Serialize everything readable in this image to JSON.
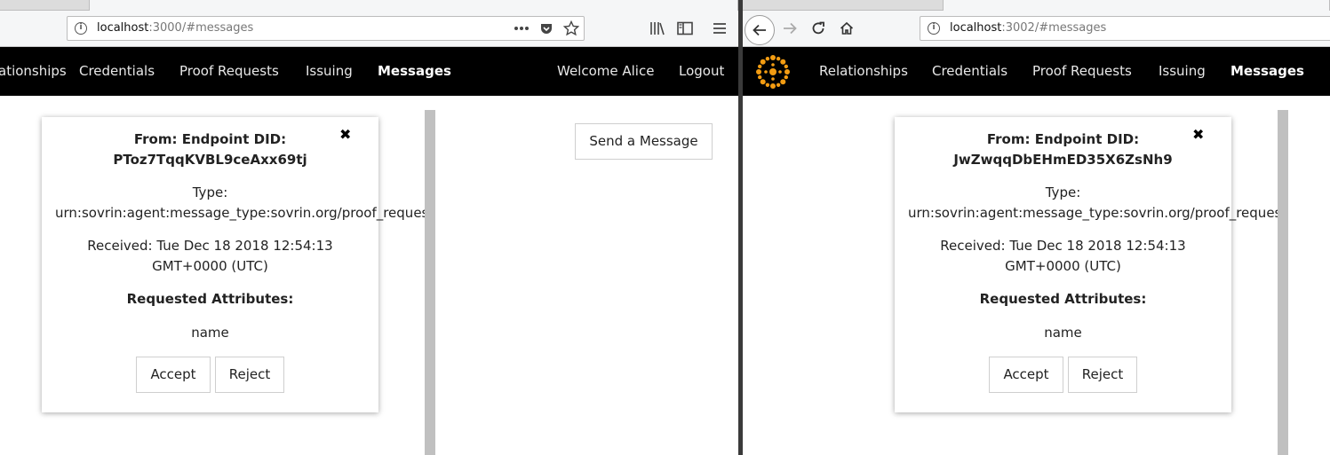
{
  "left": {
    "url_host": "localhost",
    "url_path": ":3000/#messages",
    "nav": {
      "items": [
        "ationships",
        "Credentials",
        "Proof Requests",
        "Issuing",
        "Messages"
      ],
      "welcome": "Welcome Alice",
      "logout": "Logout"
    },
    "card": {
      "from_label": "From: Endpoint DID:",
      "did": "PToz7TqqKVBL9ceAxx69tj",
      "type_label": "Type:",
      "type_value": "urn:sovrin:agent:message_type:sovrin.org/proof_request",
      "received_1": "Received: Tue Dec 18 2018 12:54:13",
      "received_2": "GMT+0000 (UTC)",
      "requested_label": "Requested Attributes:",
      "attribute": "name",
      "accept": "Accept",
      "reject": "Reject",
      "close": "✖"
    },
    "send_message": "Send a Message"
  },
  "right": {
    "url_host": "localhost",
    "url_path": ":3002/#messages",
    "nav": {
      "items": [
        "Relationships",
        "Credentials",
        "Proof Requests",
        "Issuing",
        "Messages"
      ]
    },
    "card": {
      "from_label": "From: Endpoint DID:",
      "did": "JwZwqqDbEHmED35X6ZsNh9",
      "type_label": "Type:",
      "type_value": "urn:sovrin:agent:message_type:sovrin.org/proof_request",
      "received_1": "Received: Tue Dec 18 2018 12:54:13",
      "received_2": "GMT+0000 (UTC)",
      "requested_label": "Requested Attributes:",
      "attribute": "name",
      "accept": "Accept",
      "reject": "Reject",
      "close": "✖"
    }
  },
  "colors": {
    "navbar": "#000000",
    "logo": "#f39c12",
    "card_bg": "#ffffff"
  },
  "icons": {
    "left_toolbar": [
      "info-icon",
      "more-icon",
      "pocket-icon",
      "bookmark-star-icon",
      "library-icon",
      "sidebar-icon",
      "menu-icon"
    ],
    "right_toolbar": [
      "back-icon",
      "forward-icon",
      "reload-icon",
      "home-icon",
      "info-icon"
    ]
  }
}
